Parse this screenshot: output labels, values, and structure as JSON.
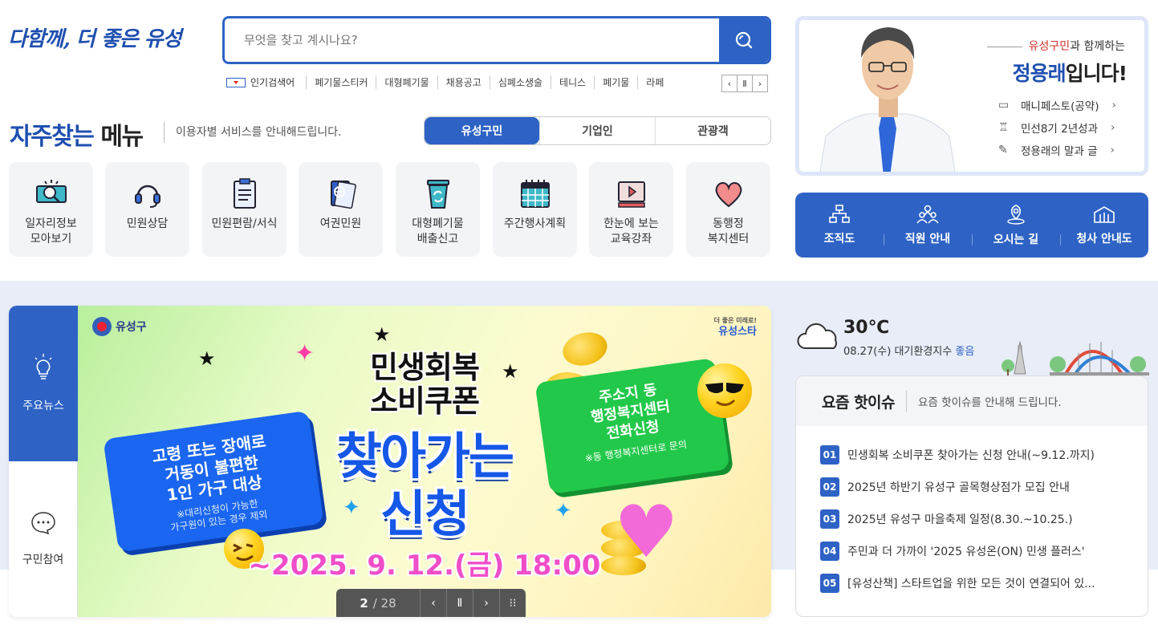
{
  "header": {
    "logo_text": "다함께, 더 좋은 유성",
    "search": {
      "placeholder": "무엇을 찾고 계시나요?"
    },
    "popular": {
      "label": "인기검색어",
      "keywords": [
        "폐기물스티커",
        "대형폐기물",
        "채용공고",
        "심폐소생술",
        "테니스",
        "폐기물",
        "라페"
      ],
      "prev": "‹",
      "pause": "Ⅱ",
      "next": "›"
    }
  },
  "frequent": {
    "title_a": "자주찾는",
    "title_b": "메뉴",
    "subtitle": "이용자별 서비스를 안내해드립니다.",
    "tabs": [
      "유성구민",
      "기업인",
      "관광객"
    ],
    "items": [
      {
        "label": "일자리정보\n모아보기",
        "icon": "job-search-icon"
      },
      {
        "label": "민원상담",
        "icon": "headset-icon"
      },
      {
        "label": "민원편람/서식",
        "icon": "document-icon"
      },
      {
        "label": "여권민원",
        "icon": "passport-icon"
      },
      {
        "label": "대형폐기물\n배출신고",
        "icon": "recycle-bin-icon"
      },
      {
        "label": "주간행사계획",
        "icon": "calendar-icon"
      },
      {
        "label": "한눈에 보는\n교육강좌",
        "icon": "video-icon"
      },
      {
        "label": "동행정\n복지센터",
        "icon": "heart-icon"
      }
    ]
  },
  "mayor": {
    "tag_red": "유성구민",
    "tag_rest": "과 함께하는",
    "name": "정용래",
    "name_suffix": "입니다!",
    "links": [
      {
        "label": "매니페스토(공약)",
        "icon": "board-icon"
      },
      {
        "label": "민선8기 2년성과",
        "icon": "trophy-icon"
      },
      {
        "label": "정용래의 말과 글",
        "icon": "note-icon"
      }
    ]
  },
  "info": {
    "items": [
      {
        "label": "조직도",
        "icon": "org-chart-icon"
      },
      {
        "label": "직원 안내",
        "icon": "staff-icon"
      },
      {
        "label": "오시는 길",
        "icon": "location-icon"
      },
      {
        "label": "청사 안내도",
        "icon": "building-icon"
      }
    ]
  },
  "news": {
    "tab_main": "주요뉴스",
    "tab_participation": "구민참여",
    "banner": {
      "brand_left": "유성구",
      "brand_right_small": "더 좋은 미래로!",
      "brand_right": "유성스타",
      "title_line1": "민생회복",
      "title_line2": "소비쿠폰",
      "big_line1": "찾아가는",
      "big_line2": "신청",
      "left_ticket_line1": "고령 또는 장애로",
      "left_ticket_line2": "거동이 불편한",
      "left_ticket_line3": "1인 가구 대상",
      "left_ticket_note1": "※대리신청이 가능한",
      "left_ticket_note2": "가구원이 있는 경우 제외",
      "right_ticket_line1": "주소지 동",
      "right_ticket_line2": "행정복지센터",
      "right_ticket_line3": "전화신청",
      "right_ticket_note": "※동 행정복지센터로 문의",
      "date": "~2025. 9. 12.(금) 18:00"
    },
    "pager": {
      "current": "2",
      "total": "/ 28",
      "prev": "‹",
      "pause": "Ⅱ",
      "next": "›",
      "menu": "⁝⁝"
    }
  },
  "weather": {
    "temp": "30℃",
    "date": "08.27(수)",
    "air_label": "대기환경지수",
    "air_value": "좋음"
  },
  "issues": {
    "title": "요즘 핫이슈",
    "subtitle": "요즘 핫이슈를 안내해 드립니다.",
    "items": [
      {
        "num": "01",
        "text": "민생회복 소비쿠폰 찾아가는 신청 안내(~9.12.까지)"
      },
      {
        "num": "02",
        "text": "2025년 하반기 유성구 골목형상점가 모집 안내"
      },
      {
        "num": "03",
        "text": "2025년 유성구 마을축제 일정(8.30.~10.25.)"
      },
      {
        "num": "04",
        "text": "주민과 더 가까이 '2025 유성온(ON) 민생 플러스'"
      },
      {
        "num": "05",
        "text": "[유성산책] 스타트업을 위한 모든 것이 연결되어 있..."
      }
    ]
  }
}
